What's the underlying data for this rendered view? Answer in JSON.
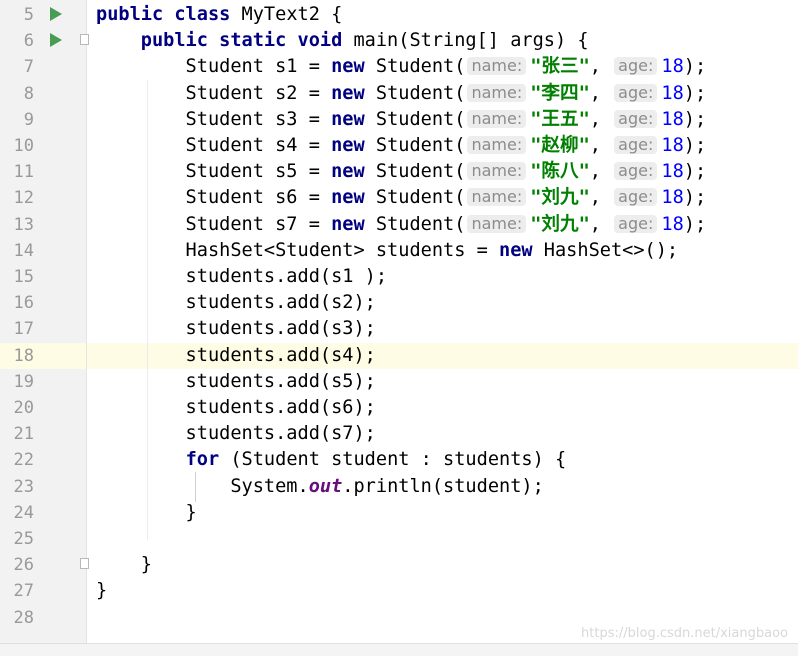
{
  "editor": {
    "current_line": 18,
    "watermark": "https://blog.csdn.net/xiangbaoo"
  },
  "lines": [
    {
      "n": "5",
      "run": true,
      "fold": false,
      "tokens": [
        {
          "t": "kw",
          "v": "public class"
        },
        {
          "t": "p",
          "v": " MyText2 {"
        }
      ]
    },
    {
      "n": "6",
      "run": true,
      "fold": true,
      "tokens": [
        {
          "t": "p",
          "v": "    "
        },
        {
          "t": "kw",
          "v": "public static void"
        },
        {
          "t": "p",
          "v": " main(String[] args) {"
        }
      ]
    },
    {
      "n": "7",
      "tokens": [
        {
          "t": "p",
          "v": "        Student s1 = "
        },
        {
          "t": "kw",
          "v": "new"
        },
        {
          "t": "p",
          "v": " Student("
        },
        {
          "t": "hint",
          "v": "name:"
        },
        {
          "t": "str",
          "v": "\"张三\""
        },
        {
          "t": "p",
          "v": ", "
        },
        {
          "t": "hint",
          "v": "age:"
        },
        {
          "t": "num",
          "v": "18"
        },
        {
          "t": "p",
          "v": ");"
        }
      ]
    },
    {
      "n": "8",
      "tokens": [
        {
          "t": "p",
          "v": "        Student s2 = "
        },
        {
          "t": "kw",
          "v": "new"
        },
        {
          "t": "p",
          "v": " Student("
        },
        {
          "t": "hint",
          "v": "name:"
        },
        {
          "t": "str",
          "v": "\"李四\""
        },
        {
          "t": "p",
          "v": ", "
        },
        {
          "t": "hint",
          "v": "age:"
        },
        {
          "t": "num",
          "v": "18"
        },
        {
          "t": "p",
          "v": ");"
        }
      ]
    },
    {
      "n": "9",
      "tokens": [
        {
          "t": "p",
          "v": "        Student s3 = "
        },
        {
          "t": "kw",
          "v": "new"
        },
        {
          "t": "p",
          "v": " Student("
        },
        {
          "t": "hint",
          "v": "name:"
        },
        {
          "t": "str",
          "v": "\"王五\""
        },
        {
          "t": "p",
          "v": ", "
        },
        {
          "t": "hint",
          "v": "age:"
        },
        {
          "t": "num",
          "v": "18"
        },
        {
          "t": "p",
          "v": ");"
        }
      ]
    },
    {
      "n": "10",
      "tokens": [
        {
          "t": "p",
          "v": "        Student s4 = "
        },
        {
          "t": "kw",
          "v": "new"
        },
        {
          "t": "p",
          "v": " Student("
        },
        {
          "t": "hint",
          "v": "name:"
        },
        {
          "t": "str",
          "v": "\"赵柳\""
        },
        {
          "t": "p",
          "v": ", "
        },
        {
          "t": "hint",
          "v": "age:"
        },
        {
          "t": "num",
          "v": "18"
        },
        {
          "t": "p",
          "v": ");"
        }
      ]
    },
    {
      "n": "11",
      "tokens": [
        {
          "t": "p",
          "v": "        Student s5 = "
        },
        {
          "t": "kw",
          "v": "new"
        },
        {
          "t": "p",
          "v": " Student("
        },
        {
          "t": "hint",
          "v": "name:"
        },
        {
          "t": "str",
          "v": "\"陈八\""
        },
        {
          "t": "p",
          "v": ", "
        },
        {
          "t": "hint",
          "v": "age:"
        },
        {
          "t": "num",
          "v": "18"
        },
        {
          "t": "p",
          "v": ");"
        }
      ]
    },
    {
      "n": "12",
      "tokens": [
        {
          "t": "p",
          "v": "        Student s6 = "
        },
        {
          "t": "kw",
          "v": "new"
        },
        {
          "t": "p",
          "v": " Student("
        },
        {
          "t": "hint",
          "v": "name:"
        },
        {
          "t": "str",
          "v": "\"刘九\""
        },
        {
          "t": "p",
          "v": ", "
        },
        {
          "t": "hint",
          "v": "age:"
        },
        {
          "t": "num",
          "v": "18"
        },
        {
          "t": "p",
          "v": ");"
        }
      ]
    },
    {
      "n": "13",
      "tokens": [
        {
          "t": "p",
          "v": "        Student s7 = "
        },
        {
          "t": "kw",
          "v": "new"
        },
        {
          "t": "p",
          "v": " Student("
        },
        {
          "t": "hint",
          "v": "name:"
        },
        {
          "t": "str",
          "v": "\"刘九\""
        },
        {
          "t": "p",
          "v": ", "
        },
        {
          "t": "hint",
          "v": "age:"
        },
        {
          "t": "num",
          "v": "18"
        },
        {
          "t": "p",
          "v": ");"
        }
      ]
    },
    {
      "n": "14",
      "tokens": [
        {
          "t": "p",
          "v": "        HashSet<Student> students = "
        },
        {
          "t": "kw",
          "v": "new"
        },
        {
          "t": "p",
          "v": " HashSet<>();"
        }
      ]
    },
    {
      "n": "15",
      "tokens": [
        {
          "t": "p",
          "v": "        students.add(s1 );"
        }
      ]
    },
    {
      "n": "16",
      "tokens": [
        {
          "t": "p",
          "v": "        students.add(s2);"
        }
      ]
    },
    {
      "n": "17",
      "tokens": [
        {
          "t": "p",
          "v": "        students.add(s3);"
        }
      ]
    },
    {
      "n": "18",
      "tokens": [
        {
          "t": "p",
          "v": "        students.add(s4);"
        }
      ]
    },
    {
      "n": "19",
      "tokens": [
        {
          "t": "p",
          "v": "        students.add(s5);"
        }
      ]
    },
    {
      "n": "20",
      "tokens": [
        {
          "t": "p",
          "v": "        students.add(s6);"
        }
      ]
    },
    {
      "n": "21",
      "tokens": [
        {
          "t": "p",
          "v": "        students.add(s7);"
        }
      ]
    },
    {
      "n": "22",
      "tokens": [
        {
          "t": "p",
          "v": "        "
        },
        {
          "t": "kw",
          "v": "for"
        },
        {
          "t": "p",
          "v": " (Student student : students) {"
        }
      ]
    },
    {
      "n": "23",
      "tokens": [
        {
          "t": "p",
          "v": "            System."
        },
        {
          "t": "field",
          "v": "out"
        },
        {
          "t": "p",
          "v": ".println(student);"
        }
      ]
    },
    {
      "n": "24",
      "tokens": [
        {
          "t": "p",
          "v": "        }"
        }
      ]
    },
    {
      "n": "25",
      "tokens": []
    },
    {
      "n": "26",
      "fold": true,
      "tokens": [
        {
          "t": "p",
          "v": "    }"
        }
      ]
    },
    {
      "n": "27",
      "tokens": [
        {
          "t": "p",
          "v": "}"
        }
      ]
    },
    {
      "n": "28",
      "tokens": []
    }
  ]
}
